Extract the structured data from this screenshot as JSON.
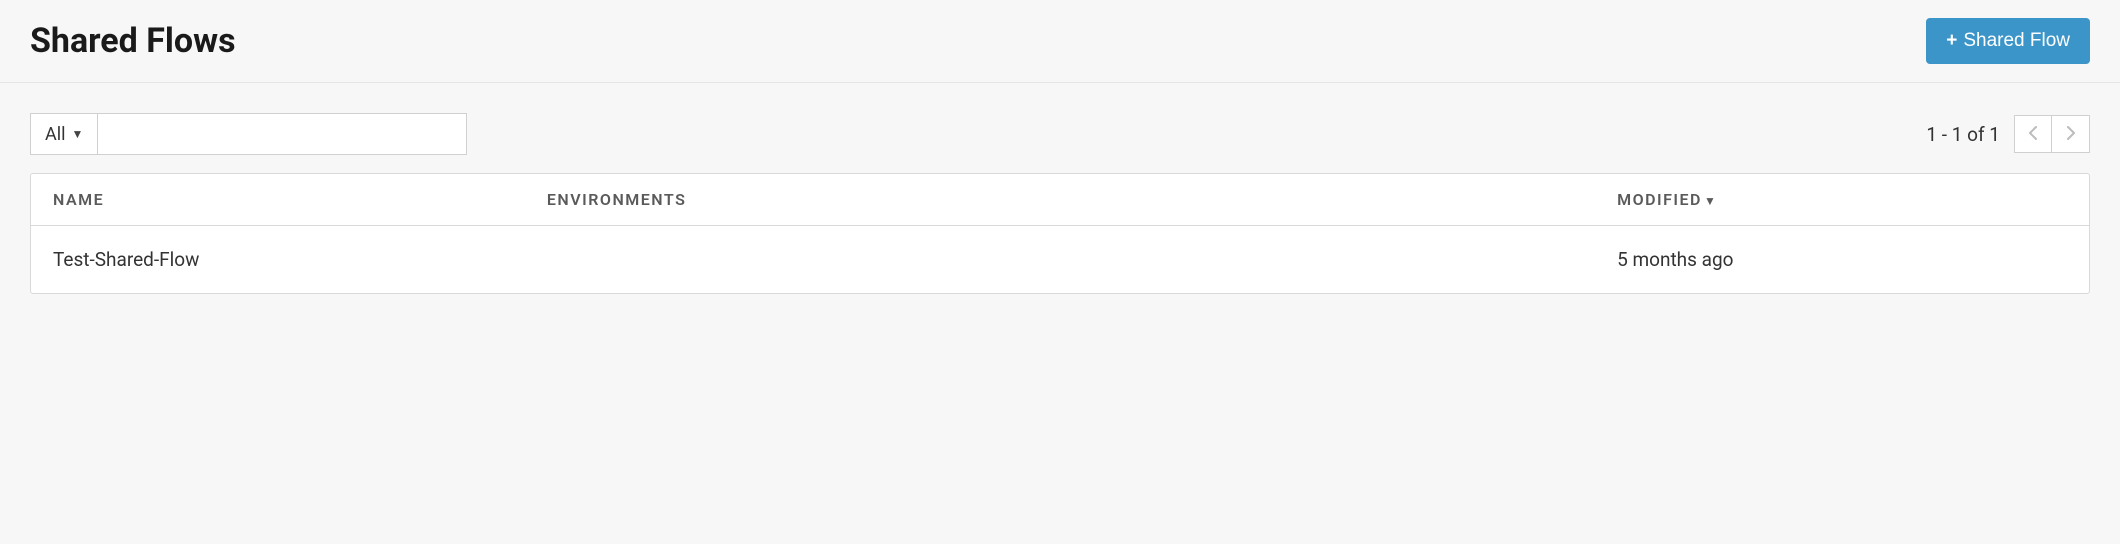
{
  "header": {
    "title": "Shared Flows",
    "add_button_label": "Shared Flow"
  },
  "filter": {
    "selected": "All",
    "search_value": ""
  },
  "pagination": {
    "info": "1 - 1 of 1"
  },
  "table": {
    "columns": {
      "name": "NAME",
      "environments": "ENVIRONMENTS",
      "modified": "MODIFIED"
    },
    "rows": [
      {
        "name": "Test-Shared-Flow",
        "environments": "",
        "modified": "5 months ago"
      }
    ]
  }
}
